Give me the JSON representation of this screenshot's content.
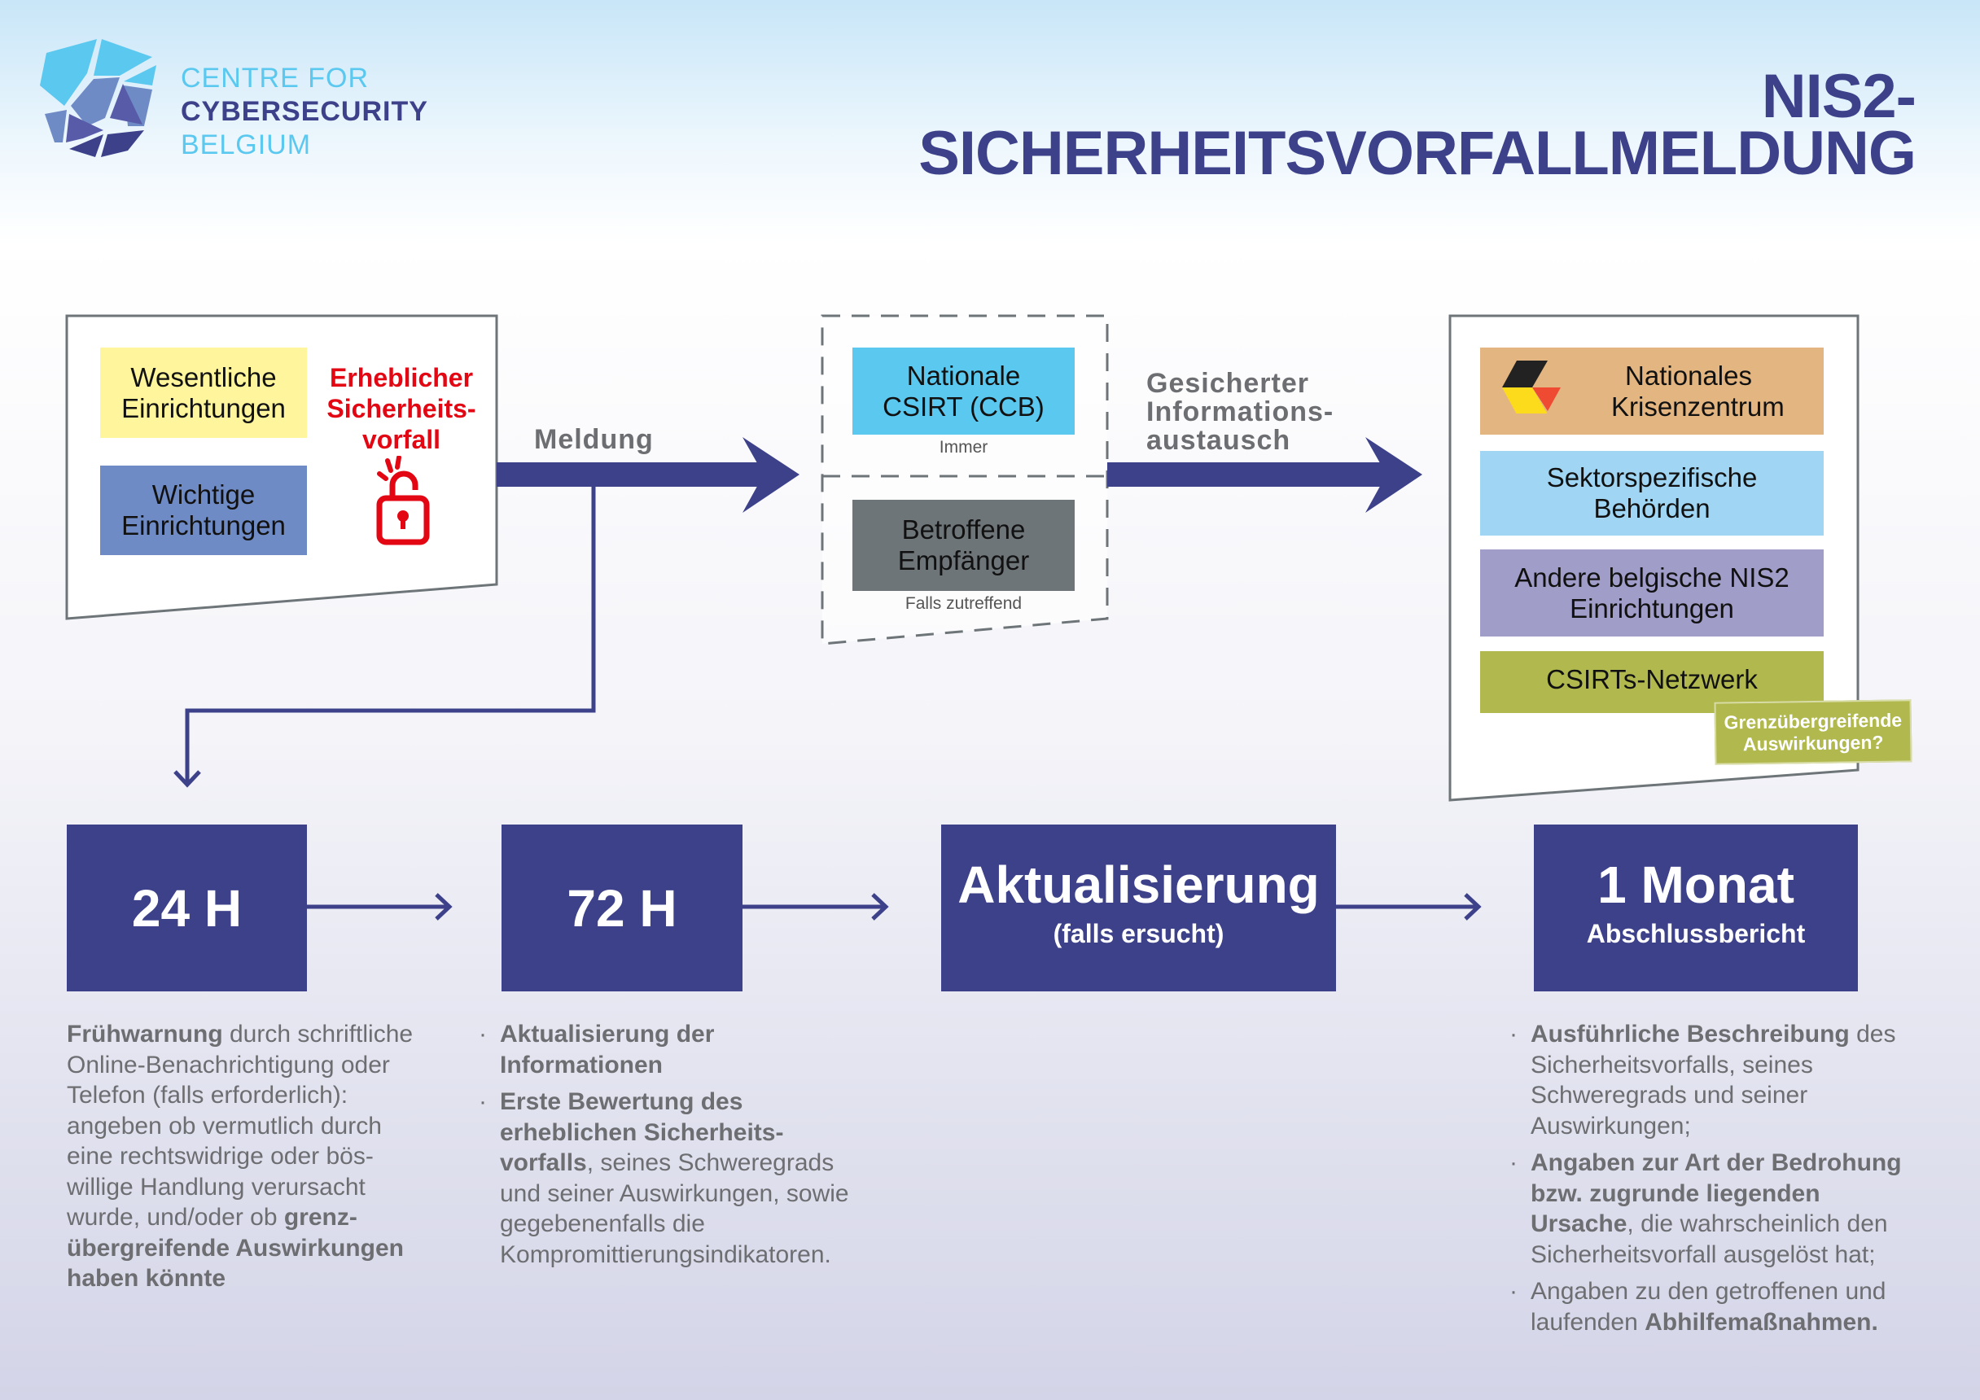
{
  "logo": {
    "line1": "CENTRE FOR",
    "line2": "CYBERSECURITY",
    "line3": "BELGIUM"
  },
  "title": {
    "line1": "NIS2-",
    "line2": "SICHERHEITSVORFALLMELDUNG"
  },
  "source": {
    "essential": "Wesentliche Einrichtungen",
    "important": "Wichtige Einrichtungen",
    "incident_l1": "Erheblicher",
    "incident_l2": "Sicherheits-",
    "incident_l3": "vorfall"
  },
  "flow": {
    "reporting": "Meldung",
    "exchange_l1": "Gesicherter",
    "exchange_l2": "Informations-",
    "exchange_l3": "austausch"
  },
  "recipients": {
    "csirt": "Nationale CSIRT (CCB)",
    "csirt_note": "Immer",
    "affected": "Betroffene Empfänger",
    "affected_note": "Falls zutreffend"
  },
  "sharing": {
    "crisis": "Nationales Krisenzentrum",
    "sector": "Sektorspezifische Behörden",
    "other": "Andere belgische NIS2 Einrichtungen",
    "network": "CSIRTs-Netzwerk",
    "crossborder": "Grenzübergreifende Auswirkungen?"
  },
  "colors": {
    "navy": "#3c418a",
    "yellow": "#fef59d",
    "blue": "#6f8bc6",
    "csirt": "#5ac8ef",
    "grey": "#6e7579",
    "orange": "#e3b581",
    "lightblue": "#a0d6f4",
    "purple": "#a09dc9",
    "green": "#b0b84e",
    "red": "#e30613"
  },
  "timeline": [
    {
      "title": "24 H"
    },
    {
      "title": "72 H"
    },
    {
      "title": "Aktualisierung",
      "subtitle": "(falls ersucht)"
    },
    {
      "title": "1 Monat",
      "subtitle": "Abschlussbericht"
    }
  ],
  "details": {
    "h24": [
      {
        "t": "Frühwarnung",
        "b": true
      },
      {
        "t": " durch schriftliche Online-Benachrichtigung oder Telefon (falls erforderlich): angeben ob vermutlich durch eine rechtswidrige oder bös-willige Handlung verursacht wurde, und/oder ob "
      },
      {
        "t": "grenz-übergreifende Auswirkungen haben könnte",
        "b": true
      }
    ],
    "h72": [
      [
        {
          "t": "Aktualisierung der Informationen",
          "b": true
        }
      ],
      [
        {
          "t": "Erste Bewertung des erheblichen Sicherheits-vorfalls",
          "b": true
        },
        {
          "t": ", seines Schweregrads und seiner Auswirkungen, sowie gegebenenfalls die Kompromittierungsindikatoren."
        }
      ]
    ],
    "month": [
      [
        {
          "t": "Ausführliche Beschreibung",
          "b": true
        },
        {
          "t": " des Sicherheitsvorfalls, seines Schweregrads und seiner Auswirkungen;"
        }
      ],
      [
        {
          "t": "Angaben zur Art der Bedrohung bzw. zugrunde liegenden Ursache",
          "b": true
        },
        {
          "t": ", die wahrscheinlich den Sicherheitsvorfall ausgelöst hat;"
        }
      ],
      [
        {
          "t": "Angaben zu den getroffenen und laufenden "
        },
        {
          "t": "Abhilfemaßnahmen.",
          "b": true
        }
      ]
    ]
  }
}
